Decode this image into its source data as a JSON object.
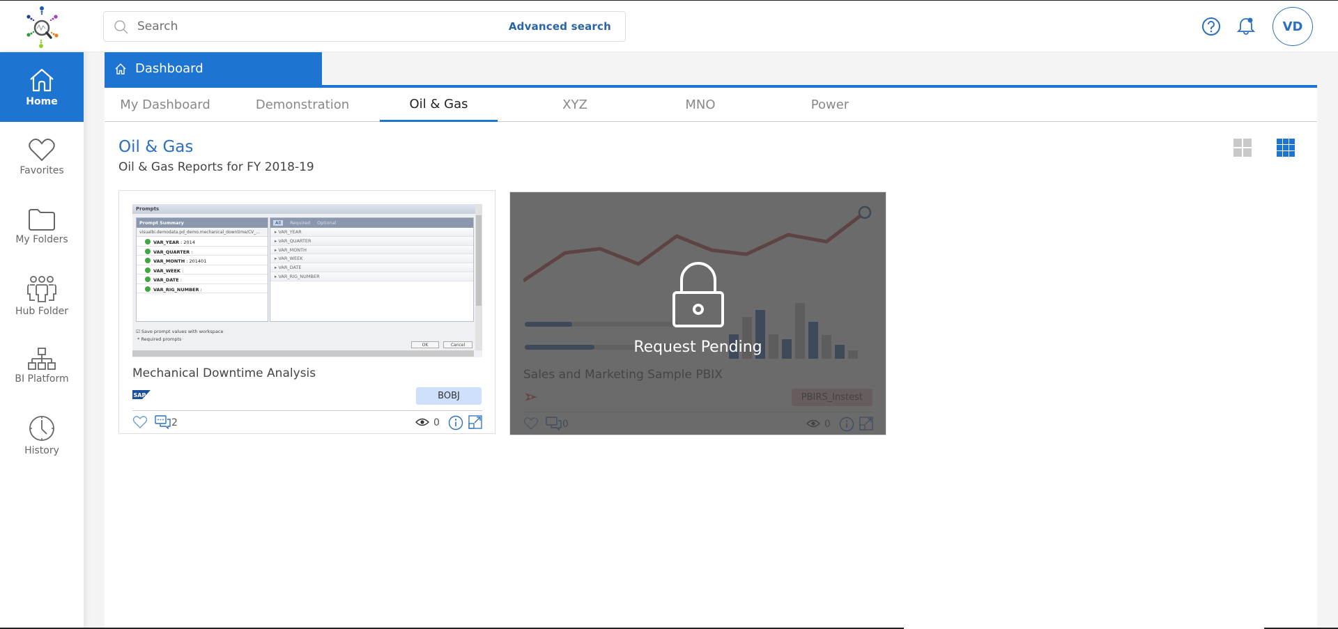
{
  "header": {
    "search_placeholder": "Search",
    "advanced_search": "Advanced search",
    "avatar_initials": "VD",
    "icons": [
      "help-icon",
      "notification-bell-icon"
    ]
  },
  "sidebar": {
    "items": [
      {
        "label": "Home",
        "icon": "home-icon",
        "active": true
      },
      {
        "label": "Favorites",
        "icon": "heart-icon",
        "active": false
      },
      {
        "label": "My Folders",
        "icon": "folder-icon",
        "active": false
      },
      {
        "label": "Hub Folder",
        "icon": "users-icon",
        "active": false
      },
      {
        "label": "BI Platform",
        "icon": "hierarchy-icon",
        "active": false
      },
      {
        "label": "History",
        "icon": "clock-icon",
        "active": false
      }
    ]
  },
  "dashboard": {
    "tab_label": "Dashboard",
    "tabs": [
      {
        "label": "My Dashboard",
        "active": false
      },
      {
        "label": "Demonstration",
        "active": false
      },
      {
        "label": "Oil & Gas",
        "active": true
      },
      {
        "label": "XYZ",
        "active": false
      },
      {
        "label": "MNO",
        "active": false
      },
      {
        "label": "Power",
        "active": false
      }
    ],
    "section_title": "Oil & Gas",
    "section_subtitle": "Oil & Gas Reports for FY 2018-19",
    "view_modes": [
      "large-grid",
      "small-grid"
    ],
    "active_view": "small-grid"
  },
  "cards": [
    {
      "title": "Mechanical Downtime Analysis",
      "source_logo": "SAP",
      "badge": "BOBJ",
      "badge_bg": "#cfe0fb",
      "comments": "2",
      "views": "0",
      "locked": false,
      "thumbnail": {
        "window_title": "Prompts",
        "summary_header": "Prompt Summary",
        "path": "visualbi.demodata.pd_demo.mechanical_downtime/CV_...",
        "prompts": [
          {
            "name": "VAR_YEAR",
            "value": "2014"
          },
          {
            "name": "VAR_QUARTER",
            "value": ""
          },
          {
            "name": "VAR_MONTH",
            "value": "201401"
          },
          {
            "name": "VAR_WEEK",
            "value": ""
          },
          {
            "name": "VAR_DATE",
            "value": ""
          },
          {
            "name": "VAR_RIG_NUMBER",
            "value": ""
          }
        ],
        "filter_tabs": [
          "All",
          "Required",
          "Optional"
        ],
        "variables": [
          "VAR_YEAR",
          "VAR_QUARTER",
          "VAR_MONTH",
          "VAR_WEEK",
          "VAR_DATE",
          "VAR_RIG_NUMBER"
        ],
        "save_option": "Save prompt values with workspace",
        "required_note": "* Required prompts",
        "ok": "OK",
        "cancel": "Cancel"
      }
    },
    {
      "title": "Sales and Marketing Sample PBIX",
      "source_logo": "Power BI Report Server",
      "badge": "PBIRS_Instest",
      "badge_bg": "#e9b9c0",
      "comments": "0",
      "views": "0",
      "locked": true,
      "status": "Request Pending"
    }
  ]
}
